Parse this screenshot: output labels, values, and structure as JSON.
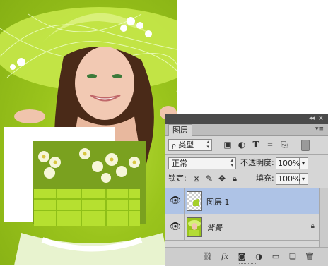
{
  "panel": {
    "tab_label": "图层",
    "filter": {
      "kind_label": "类型"
    },
    "blend": {
      "mode": "正常",
      "opacity_label": "不透明度:",
      "opacity_value": "100%"
    },
    "lock_row": {
      "lock_label": "锁定:",
      "fill_label": "填充:",
      "fill_value": "100%"
    },
    "layers": [
      {
        "name": "图层 1",
        "selected": true
      },
      {
        "name": "背景",
        "locked": true
      }
    ]
  },
  "colors": {
    "selection": "#aec3e6",
    "panel_bg": "#d6d6d6",
    "canvas_green": "#9ac41c"
  },
  "icons": [
    "search-icon",
    "image-filter-icon",
    "adjustment-filter-icon",
    "type-filter-icon",
    "shape-filter-icon",
    "smart-object-filter-icon",
    "filter-toggle-icon",
    "lock-pixels-icon",
    "lock-brush-icon",
    "lock-move-icon",
    "lock-all-icon",
    "eye-icon",
    "lock-icon",
    "link-icon",
    "fx-icon",
    "mask-icon",
    "adjustment-icon",
    "folder-icon",
    "new-layer-icon",
    "trash-icon"
  ]
}
